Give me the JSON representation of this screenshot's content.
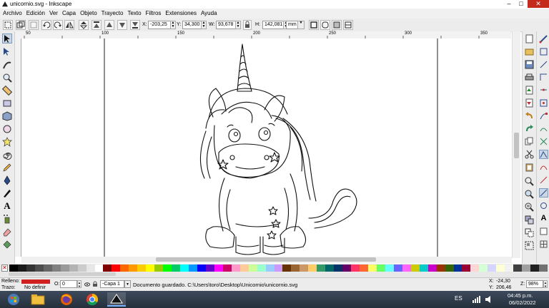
{
  "window": {
    "title": "unicornio.svg - Inkscape",
    "controls": [
      "–",
      "□",
      "✕"
    ]
  },
  "menu": [
    "Archivo",
    "Edición",
    "Ver",
    "Capa",
    "Objeto",
    "Trayecto",
    "Texto",
    "Filtros",
    "Extensiones",
    "Ayuda"
  ],
  "toolbar": {
    "x_label": "X:",
    "x_value": "-203,25",
    "y_label": "Y:",
    "y_value": "34,300",
    "w_label": "W:",
    "w_value": "93,678",
    "h_label": "H:",
    "h_value": "142,081",
    "units": "mm"
  },
  "ruler_ticks": [
    "50",
    "100",
    "150",
    "200",
    "250",
    "300",
    "350"
  ],
  "tools": [
    "selector-tool",
    "node-tool",
    "tweak-tool",
    "zoom-tool",
    "measure-tool",
    "rectangle-tool",
    "3d-box-tool",
    "ellipse-tool",
    "star-tool",
    "spiral-tool",
    "pencil-tool",
    "pen-tool",
    "calligraphy-tool",
    "text-tool",
    "spray-tool",
    "eraser-tool",
    "paint-bucket-tool"
  ],
  "palette": [
    "#000000",
    "#1a1a1a",
    "#333333",
    "#4d4d4d",
    "#666666",
    "#808080",
    "#999999",
    "#b3b3b3",
    "#cccccc",
    "#e6e6e6",
    "#ffffff",
    "#800000",
    "#ff0000",
    "#ff6600",
    "#ff9900",
    "#ffcc00",
    "#ffff00",
    "#99cc00",
    "#00ff00",
    "#00cc66",
    "#00ffff",
    "#0099ff",
    "#0000ff",
    "#6600cc",
    "#ff00ff",
    "#cc0066",
    "#ff99cc",
    "#ffcc99",
    "#ccff99",
    "#99ffcc",
    "#99ccff",
    "#cc99ff",
    "#663300",
    "#996633",
    "#cc9966",
    "#ffcc66",
    "#339966",
    "#006666",
    "#003366",
    "#660066",
    "#ff3366",
    "#ff6633",
    "#ffff66",
    "#66ff66",
    "#66ffff",
    "#6666ff",
    "#ff66ff",
    "#cccc00",
    "#00cccc",
    "#cc00cc",
    "#993300",
    "#336600",
    "#003399",
    "#990033",
    "#ffd5d5",
    "#d5ffd5",
    "#d5d5ff",
    "#ffffd5",
    "#f2f2f2",
    "#404040",
    "#a0a0a0",
    "#202020",
    "#707070"
  ],
  "status": {
    "fill_label": "Relleno:",
    "stroke_label": "Trazo:",
    "stroke_value": "No definir",
    "fill_color": "#d02020",
    "opacity_label": "O:",
    "opacity_value": "0",
    "layer": "-Capa 1",
    "message": "Documento guardado. C:\\Users\\toro\\Desktop\\Unicornio\\unicornio.svg",
    "cursor_x_label": "X:",
    "cursor_x": "-24,30",
    "cursor_y_label": "Y:",
    "cursor_y": "206,46",
    "zoom_label": "Z:",
    "zoom": "98%"
  },
  "taskbar": {
    "language": "ES",
    "time": "04:45 p.m.",
    "date": "06/02/2022"
  }
}
